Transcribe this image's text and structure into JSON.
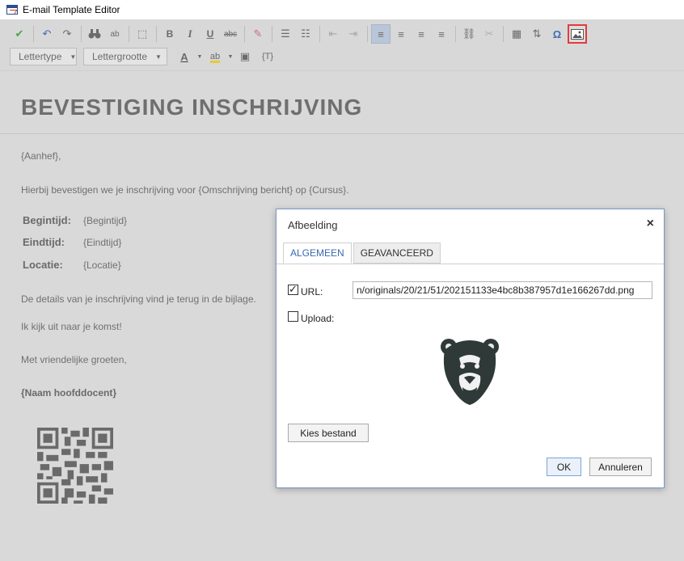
{
  "window": {
    "title": "E-mail Template Editor"
  },
  "toolbar": {
    "row1": [
      {
        "name": "check-icon",
        "glyph": "✔"
      },
      {
        "name": "undo-icon",
        "glyph": "↶"
      },
      {
        "name": "redo-icon",
        "glyph": "↷"
      },
      {
        "name": "find-icon",
        "glyph": "👁"
      },
      {
        "name": "replace-icon",
        "glyph": "ab"
      },
      {
        "name": "select-all-icon",
        "glyph": "⬚"
      },
      {
        "name": "bold-icon",
        "glyph": "B"
      },
      {
        "name": "italic-icon",
        "glyph": "I"
      },
      {
        "name": "underline-icon",
        "glyph": "U"
      },
      {
        "name": "strikethrough-icon",
        "glyph": "abc"
      },
      {
        "name": "remove-format-icon",
        "glyph": "✎"
      },
      {
        "name": "numbered-list-icon",
        "glyph": "☰"
      },
      {
        "name": "bulleted-list-icon",
        "glyph": "☷"
      },
      {
        "name": "outdent-icon",
        "glyph": "⇤"
      },
      {
        "name": "indent-icon",
        "glyph": "⇥"
      },
      {
        "name": "align-left-icon",
        "glyph": "≡"
      },
      {
        "name": "align-center-icon",
        "glyph": "≡"
      },
      {
        "name": "align-right-icon",
        "glyph": "≡"
      },
      {
        "name": "justify-icon",
        "glyph": "≡"
      },
      {
        "name": "link-icon",
        "glyph": "⛓"
      },
      {
        "name": "unlink-icon",
        "glyph": "✂"
      },
      {
        "name": "table-icon",
        "glyph": "▦"
      },
      {
        "name": "text-direction-icon",
        "glyph": "⇅"
      },
      {
        "name": "special-char-icon",
        "glyph": "Ω"
      },
      {
        "name": "image-icon",
        "glyph": "🖼"
      }
    ],
    "font_combo": "Lettertype",
    "size_combo": "Lettergrootte",
    "text_color_glyph": "A",
    "bg_color_glyph": "ab",
    "qr_glyph": "▣",
    "placeholder_glyph": "{T}"
  },
  "editor": {
    "heading": "BEVESTIGING INSCHRIJVING",
    "greeting": "{Aanhef},",
    "intro": "Hierbij bevestigen we je inschrijving voor {Omschrijving bericht} op {Cursus}.",
    "fields": [
      {
        "label": "Begintijd:",
        "value": "{Begintijd}"
      },
      {
        "label": "Eindtijd:",
        "value": "{Eindtijd}"
      },
      {
        "label": "Locatie:",
        "value": "{Locatie}"
      }
    ],
    "details": "De details van je inschrijving vind je terug in de bijlage.",
    "closing1": "Ik kijk uit naar je komst!",
    "closing2": "Met vriendelijke groeten,",
    "signature": "{Naam hoofddocent}"
  },
  "dialog": {
    "title": "Afbeelding",
    "close": "×",
    "tabs": [
      "ALGEMEEN",
      "GEAVANCEERD"
    ],
    "url_label": "URL:",
    "url_value": "n/originals/20/21/51/202151133e4bc8b387957d1e166267dd.png",
    "upload_label": "Upload:",
    "choose_file": "Kies bestand",
    "ok": "OK",
    "cancel": "Annuleren"
  },
  "colors": {
    "accent": "#3a6ab0",
    "highlight_border": "#e23b3b",
    "check_green": "#4aa64a"
  }
}
